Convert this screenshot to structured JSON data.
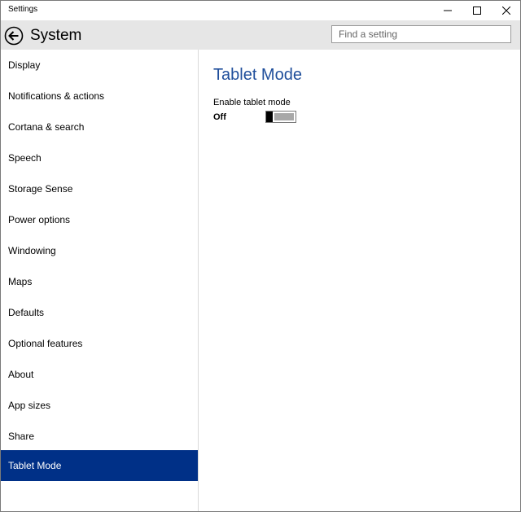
{
  "window": {
    "title": "Settings",
    "minimize_icon": "minimize-icon",
    "maximize_icon": "maximize-icon",
    "close_icon": "close-icon"
  },
  "header": {
    "back_icon": "back-arrow-icon",
    "title": "System",
    "search": {
      "placeholder": "Find a setting",
      "value": ""
    }
  },
  "sidebar": {
    "items": [
      {
        "label": "Display"
      },
      {
        "label": "Notifications & actions"
      },
      {
        "label": "Cortana & search"
      },
      {
        "label": "Speech"
      },
      {
        "label": "Storage Sense"
      },
      {
        "label": "Power options"
      },
      {
        "label": "Windowing"
      },
      {
        "label": "Maps"
      },
      {
        "label": "Defaults"
      },
      {
        "label": "Optional features"
      },
      {
        "label": "About"
      },
      {
        "label": "App sizes"
      },
      {
        "label": "Share"
      },
      {
        "label": "Tablet Mode",
        "selected": true
      }
    ]
  },
  "content": {
    "title": "Tablet Mode",
    "setting_label": "Enable tablet mode",
    "toggle_state": "Off",
    "toggle_on": false
  },
  "colors": {
    "accent": "#003087",
    "title_blue": "#1f4e9b",
    "header_bg": "#e6e6e6"
  }
}
